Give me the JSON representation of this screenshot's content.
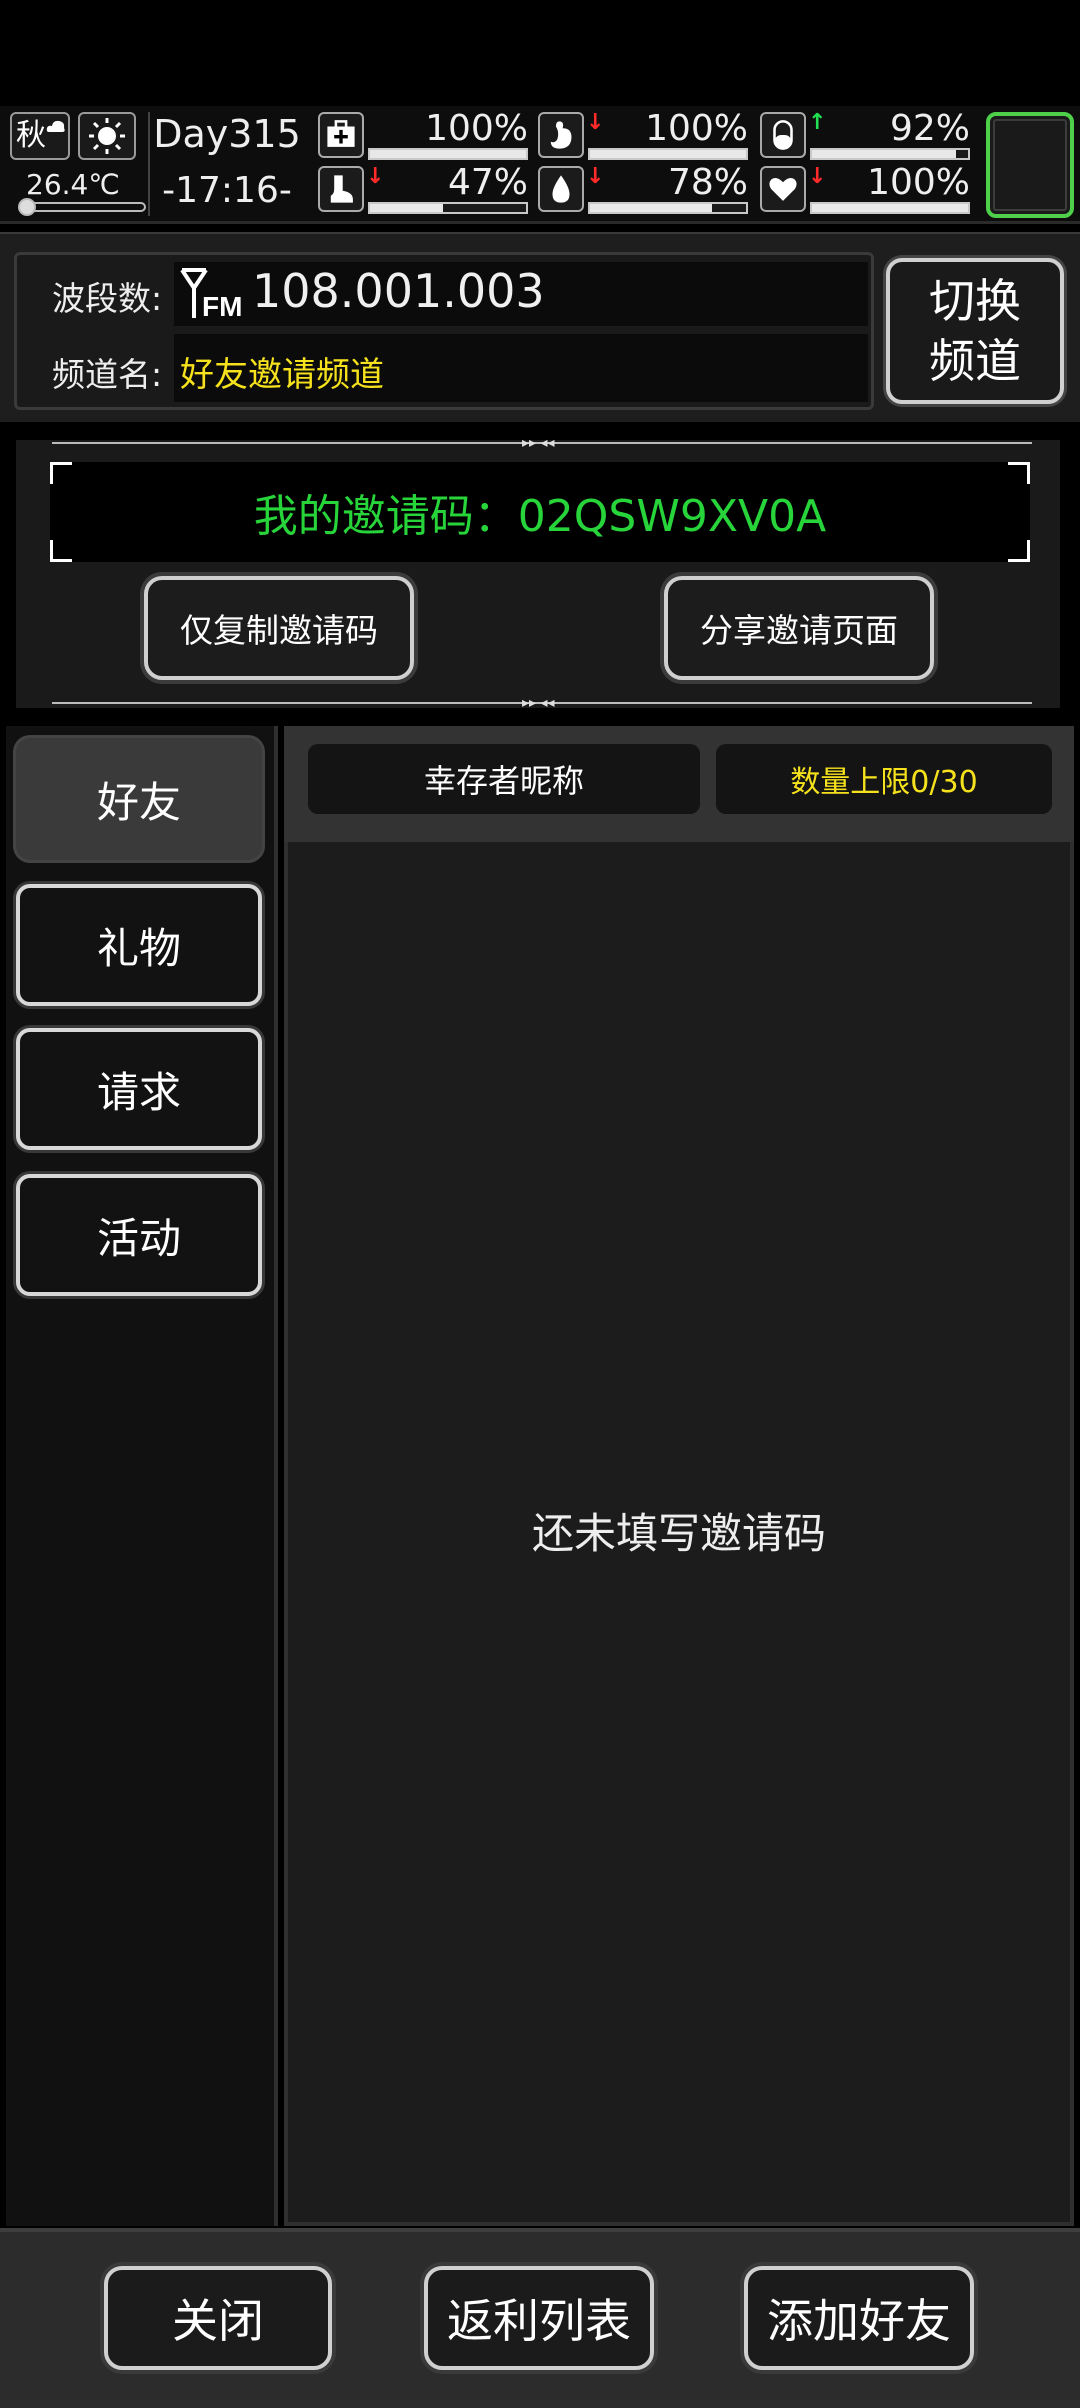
{
  "status": {
    "season": "秋",
    "temperature": "26.4℃",
    "day": "Day315",
    "time": "-17:16-",
    "stats": [
      {
        "icon": "medkit-icon",
        "value": "100%",
        "level": 1.0,
        "trend": "none"
      },
      {
        "icon": "stomach-icon",
        "value": "100%",
        "level": 1.0,
        "trend": "down"
      },
      {
        "icon": "pill-icon",
        "value": "92%",
        "level": 0.92,
        "trend": "up"
      },
      {
        "icon": "foot-icon",
        "value": "47%",
        "level": 0.47,
        "trend": "down"
      },
      {
        "icon": "water-drop-icon",
        "value": "78%",
        "level": 0.78,
        "trend": "down"
      },
      {
        "icon": "heart-icon",
        "value": "100%",
        "level": 1.0,
        "trend": "down"
      }
    ]
  },
  "radio": {
    "band_label": "波段数:",
    "frequency": "108.001.003",
    "channel_label": "频道名:",
    "channel_name": "好友邀请频道",
    "switch_line1": "切换",
    "switch_line2": "频道"
  },
  "invite": {
    "code_text": "我的邀请码：02QSW9XV0A",
    "copy_button": "仅复制邀请码",
    "share_button": "分享邀请页面"
  },
  "tabs": [
    {
      "label": "好友",
      "active": true
    },
    {
      "label": "礼物",
      "active": false
    },
    {
      "label": "请求",
      "active": false
    },
    {
      "label": "活动",
      "active": false
    }
  ],
  "list": {
    "header_name": "幸存者昵称",
    "header_limit": "数量上限0/30",
    "empty_message": "还未填写邀请码"
  },
  "footer": {
    "close": "关闭",
    "rebate": "返利列表",
    "add_friend": "添加好友"
  },
  "colors": {
    "accent_green": "#27d43a",
    "accent_yellow": "#f6e21c",
    "alert_red": "#ff2a2a",
    "slot_green": "#4fd04a"
  }
}
